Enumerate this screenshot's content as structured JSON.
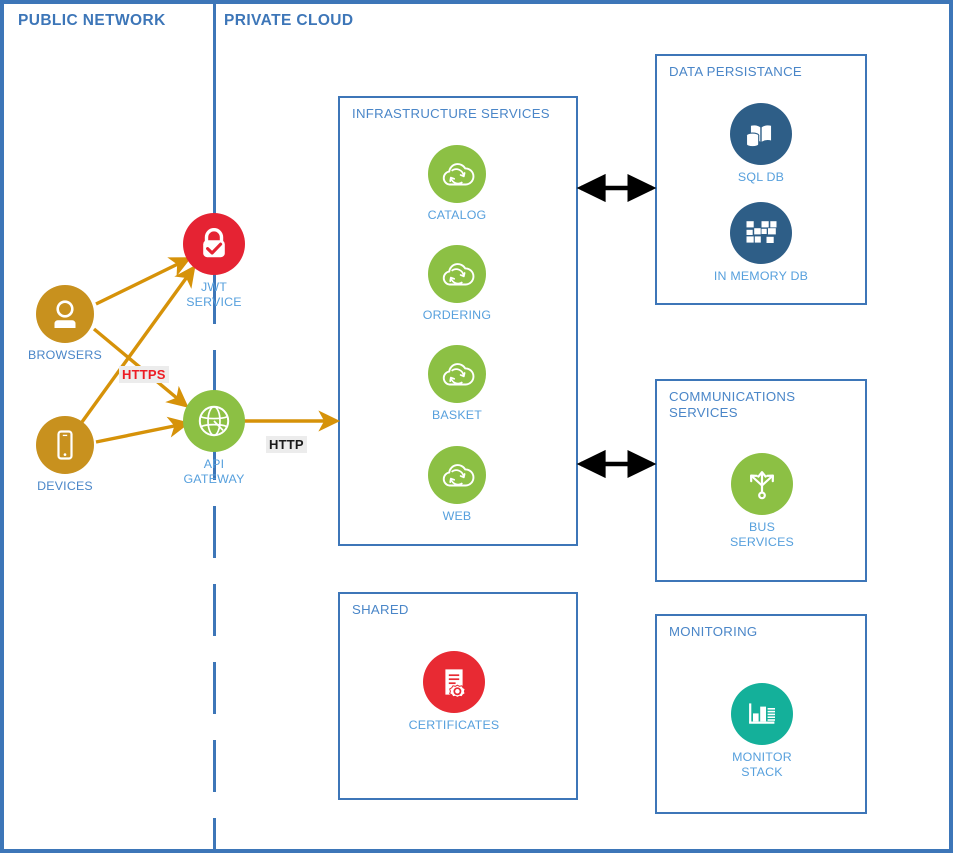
{
  "zones": {
    "public": "PUBLIC NETWORK",
    "private": "PRIVATE CLOUD"
  },
  "groups": {
    "infrastructure": "INFRASTRUCTURE SERVICES",
    "shared": "SHARED",
    "data_persistence": "DATA PERSISTANCE",
    "communications": "COMMUNICATIONS\nSERVICES",
    "monitoring": "MONITORING"
  },
  "nodes": {
    "browsers": {
      "label": "BROWSERS",
      "icon": "user-icon",
      "color": "#c8911e"
    },
    "devices": {
      "label": "DEVICES",
      "icon": "mobile-phone-icon",
      "color": "#c8911e"
    },
    "jwt": {
      "label": "JWT\nSERVICE",
      "icon": "lock-check-icon",
      "color": "#e52333"
    },
    "gateway": {
      "label": "API\nGATEWAY",
      "icon": "globe-icon",
      "color": "#8cc044"
    },
    "catalog": {
      "label": "CATALOG",
      "icon": "cloud-sync-icon",
      "color": "#8cc044"
    },
    "ordering": {
      "label": "ORDERING",
      "icon": "cloud-sync-icon",
      "color": "#8cc044"
    },
    "basket": {
      "label": "BASKET",
      "icon": "cloud-sync-icon",
      "color": "#8cc044"
    },
    "web": {
      "label": "WEB",
      "icon": "cloud-sync-icon",
      "color": "#8cc044"
    },
    "certificates": {
      "label": "CERTIFICATES",
      "icon": "certificate-icon",
      "color": "#e82a33"
    },
    "sqldb": {
      "label": "SQL DB",
      "icon": "database-book-icon",
      "color": "#2e5e87"
    },
    "inmemorydb": {
      "label": "IN MEMORY DB",
      "icon": "memory-grid-icon",
      "color": "#2e5e87"
    },
    "busservices": {
      "label": "BUS\nSERVICES",
      "icon": "fanout-arrows-icon",
      "color": "#8cc044"
    },
    "monitorstack": {
      "label": "MONITOR\nSTACK",
      "icon": "bar-chart-icon",
      "color": "#14b09a"
    }
  },
  "protocols": {
    "https": "HTTPS",
    "http": "HTTP"
  },
  "connections": [
    {
      "from": "browsers",
      "to": "jwt",
      "style": "arrow",
      "protocol": "HTTPS"
    },
    {
      "from": "browsers",
      "to": "gateway",
      "style": "arrow",
      "protocol": "HTTPS"
    },
    {
      "from": "devices",
      "to": "jwt",
      "style": "arrow",
      "protocol": "HTTPS"
    },
    {
      "from": "devices",
      "to": "gateway",
      "style": "arrow",
      "protocol": "HTTPS"
    },
    {
      "from": "gateway",
      "to": "infrastructure",
      "style": "arrow",
      "protocol": "HTTP"
    },
    {
      "from": "infrastructure",
      "to": "data_persistence",
      "style": "double-arrow",
      "protocol": ""
    },
    {
      "from": "infrastructure",
      "to": "communications",
      "style": "double-arrow",
      "protocol": ""
    }
  ],
  "colors": {
    "frame_blue": "#3d76b8",
    "label_blue": "#4a86c8",
    "caption_blue": "#57a0dd",
    "gold": "#c8911e",
    "green": "#8cc044",
    "red": "#e52333",
    "dark_blue": "#2e5e87",
    "teal": "#14b09a",
    "arrow_gold": "#d69209",
    "arrow_black": "#000000",
    "https_red": "#ed1c24"
  }
}
